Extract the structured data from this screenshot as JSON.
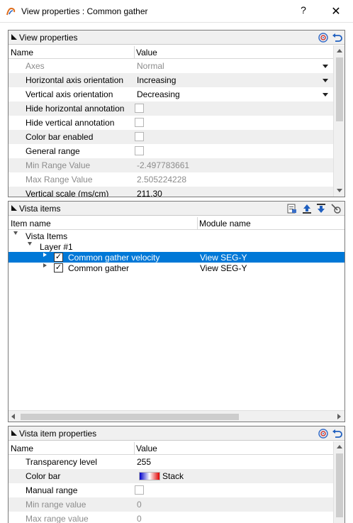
{
  "window": {
    "title": "View properties : Common gather",
    "help_label": "?",
    "close_label": "✕"
  },
  "view_properties": {
    "header": "View properties",
    "columns": [
      "Name",
      "Value"
    ],
    "rows": [
      {
        "name": "Axes",
        "value": "Normal"
      },
      {
        "name": "Horizontal axis orientation",
        "value": "Increasing"
      },
      {
        "name": "Vertical axis orientation",
        "value": "Decreasing"
      },
      {
        "name": "Hide horizontal annotation",
        "value": ""
      },
      {
        "name": "Hide vertical annotation",
        "value": ""
      },
      {
        "name": "Color bar enabled",
        "value": ""
      },
      {
        "name": "General range",
        "value": ""
      },
      {
        "name": "Min Range Value",
        "value": "-2.497783661"
      },
      {
        "name": "Max Range Value",
        "value": "2.505224228"
      },
      {
        "name": "Vertical scale (ms/cm)",
        "value": "211.30"
      }
    ]
  },
  "vista_items": {
    "header": "Vista items",
    "columns": [
      "Item name",
      "Module name"
    ],
    "tree": {
      "root": "Vista Items",
      "layer": "Layer  #1",
      "items": [
        {
          "name": "Common gather velocity",
          "module": "View SEG-Y",
          "checked": "✓"
        },
        {
          "name": "Common gather",
          "module": "View SEG-Y",
          "checked": "✓"
        }
      ]
    }
  },
  "vista_item_properties": {
    "header": "Vista item properties",
    "columns": [
      "Name",
      "Value"
    ],
    "rows": [
      {
        "name": "Transparency level",
        "value": "255"
      },
      {
        "name": "Color bar",
        "value": "Stack"
      },
      {
        "name": "Manual range",
        "value": ""
      },
      {
        "name": "Min range value",
        "value": "0"
      },
      {
        "name": "Max range value",
        "value": "0"
      }
    ]
  },
  "colors": {
    "selection": "#0078d7",
    "alt_row": "#efefef",
    "header_bg": "#f0f0f0"
  },
  "icons": [
    "app-logo-icon",
    "help-icon",
    "close-icon",
    "collapse-triangle-icon",
    "target-icon",
    "reset-icon",
    "properties-icon",
    "move-up-icon",
    "move-down-icon",
    "remove-icon"
  ]
}
